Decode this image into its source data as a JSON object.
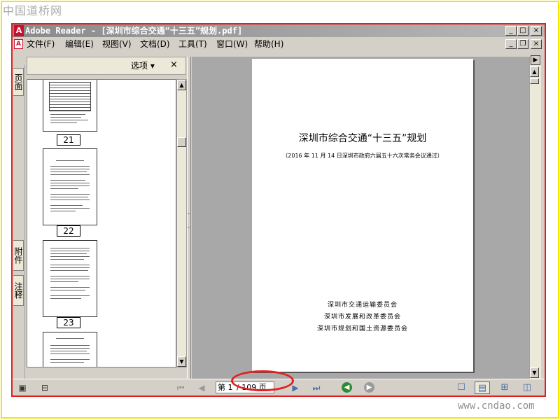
{
  "watermark": {
    "top": "中国道桥网",
    "bottom": "www.cndao.com"
  },
  "window": {
    "title": "Adobe Reader - [深圳市综合交通“十三五”规划.pdf]",
    "buttons": [
      "_",
      "□",
      "×"
    ],
    "doc_buttons": [
      "_",
      "❐",
      "×"
    ]
  },
  "menu": [
    {
      "label": "文件(F)"
    },
    {
      "label": "编辑(E)"
    },
    {
      "label": "视图(V)"
    },
    {
      "label": "文档(D)"
    },
    {
      "label": "工具(T)"
    },
    {
      "label": "窗口(W)"
    },
    {
      "label": "帮助(H)"
    }
  ],
  "nav_tabs": {
    "pages": "页面",
    "attachments": "附件",
    "comments": "注释"
  },
  "panel": {
    "options_label": "选项 ▾",
    "close": "×"
  },
  "thumbnails": [
    {
      "page": "21"
    },
    {
      "page": "22"
    },
    {
      "page": "23"
    }
  ],
  "document": {
    "title": "深圳市综合交通“十三五”规划",
    "subtitle": "（2016 年 11 月 14 日深圳市政府六届五十六次常务会议通过）",
    "orgs": [
      "深圳市交通运输委员会",
      "深圳市发展和改革委员会",
      "深圳市规划和国土资源委员会"
    ]
  },
  "statusbar": {
    "page_prefix": "第",
    "page_current": "1",
    "page_total": "/ 109 页"
  }
}
